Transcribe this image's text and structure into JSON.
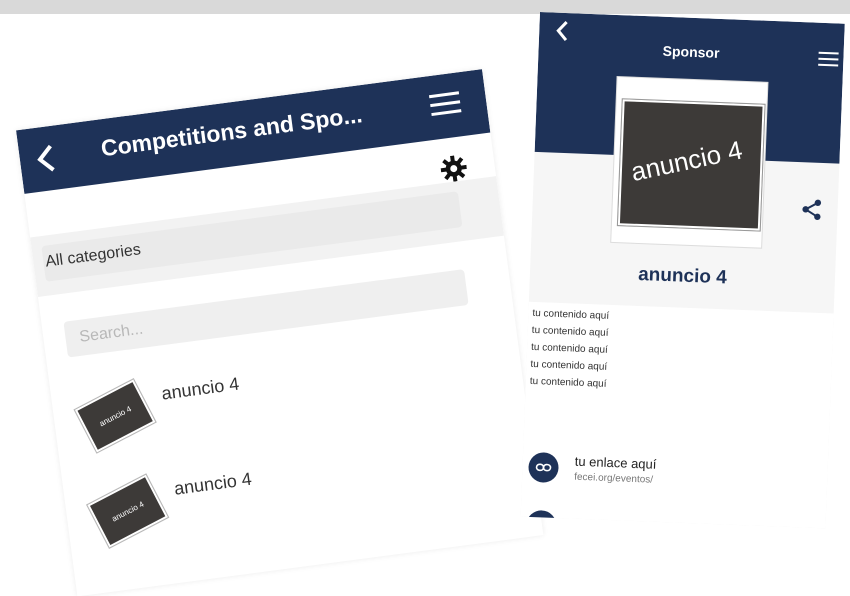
{
  "left_screen": {
    "title": "Competitions and Spo...",
    "category_label": "All categories",
    "search": {
      "placeholder": "Search..."
    },
    "items": [
      {
        "label": "anuncio 4",
        "thumb_text": "anuncio 4"
      },
      {
        "label": "anuncio 4",
        "thumb_text": "anuncio 4"
      }
    ]
  },
  "right_screen": {
    "title": "Sponsor",
    "image_text": "anuncio 4",
    "heading": "anuncio 4",
    "content_lines": [
      "tu contenido aquí",
      "tu contenido aquí",
      "tu contenido aquí",
      "tu contenido aquí",
      "tu contenido aquí"
    ],
    "link": {
      "title": "tu enlace aquí",
      "url": "fecei.org/eventos/"
    }
  },
  "colors": {
    "navy": "#1e3258",
    "thumbnail": "#3d3a38"
  },
  "icons": [
    "back-icon",
    "menu-icon",
    "gear-icon",
    "share-icon",
    "link-icon"
  ]
}
